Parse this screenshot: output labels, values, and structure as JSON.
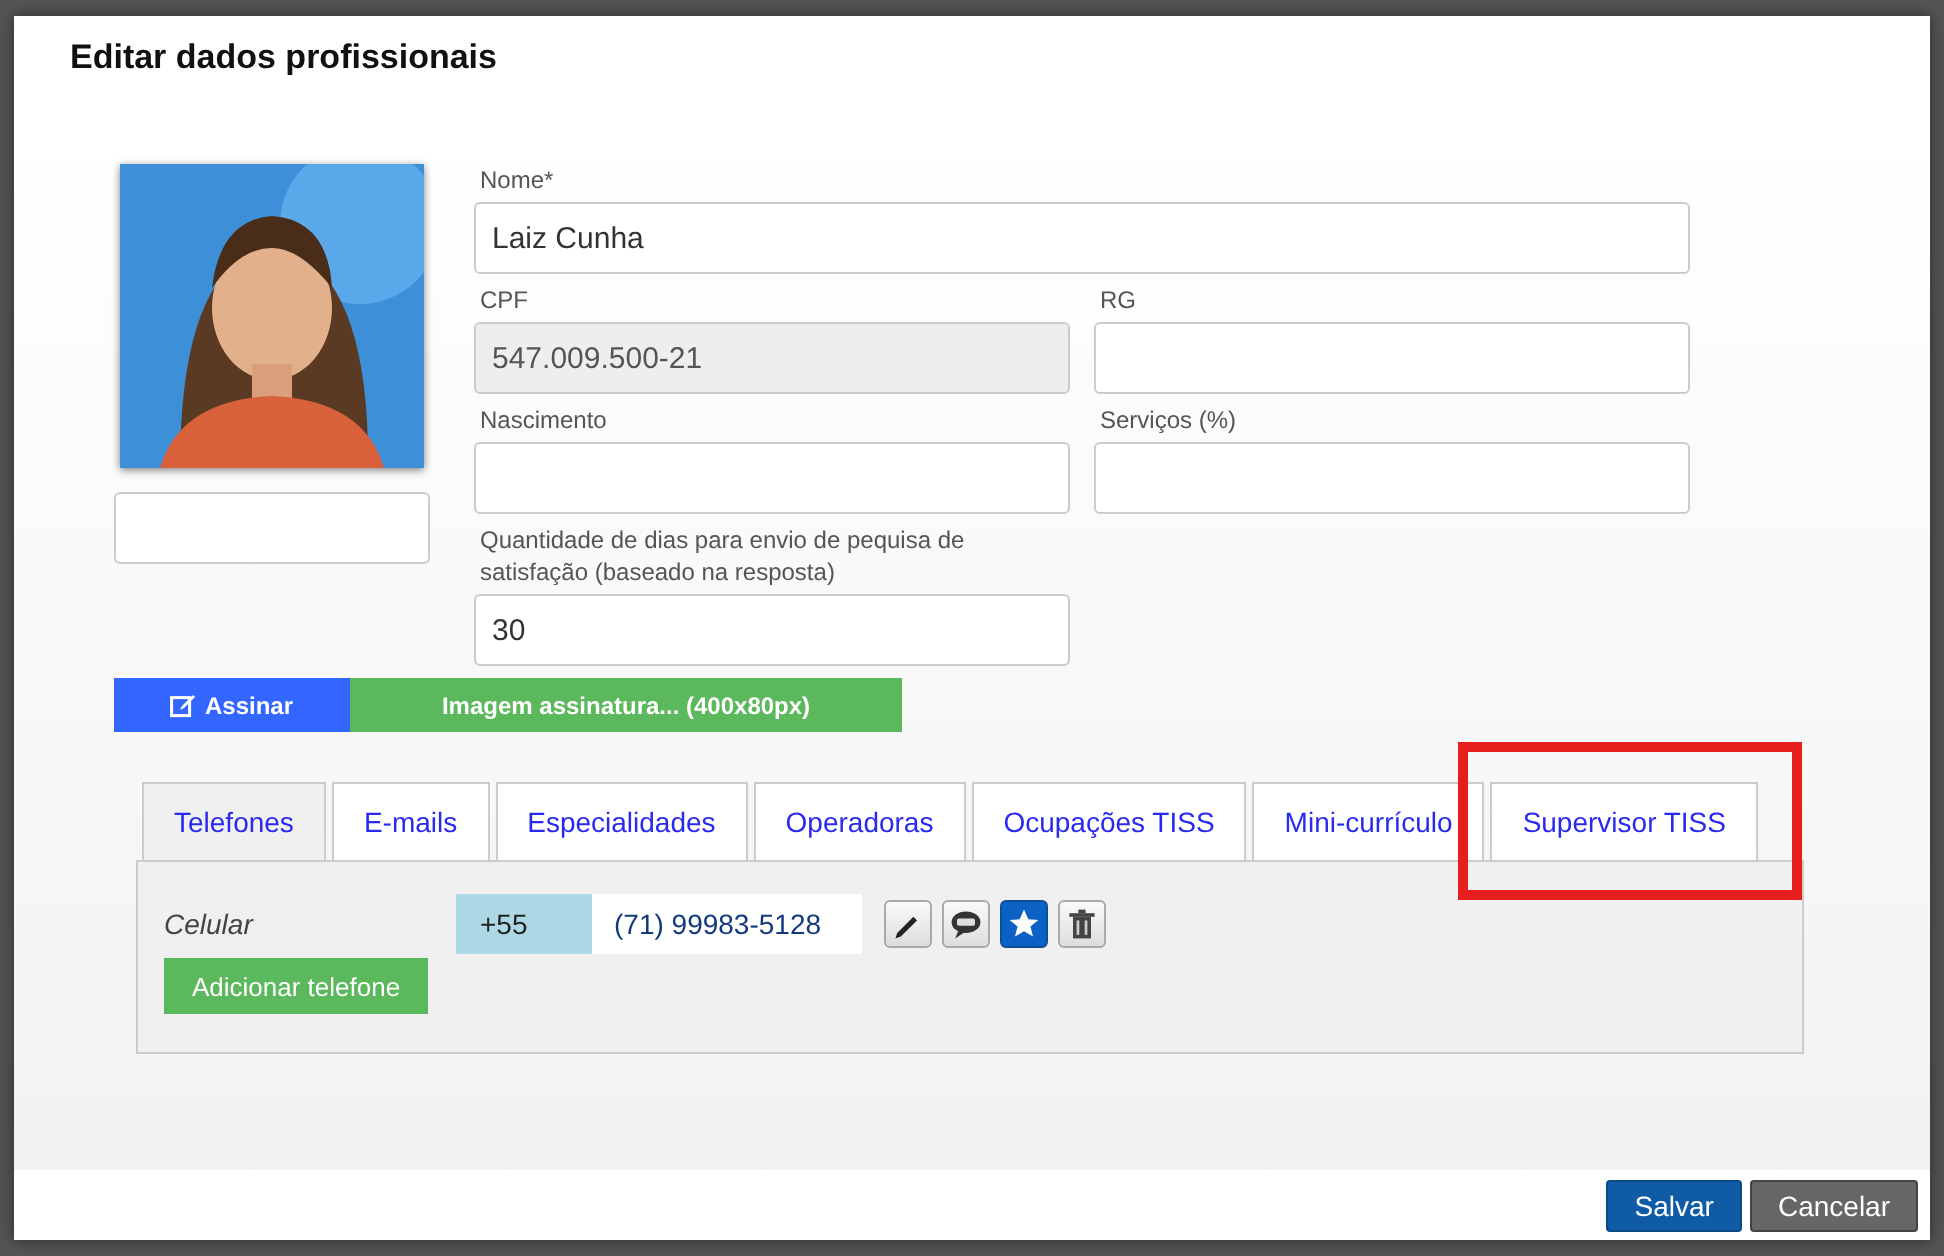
{
  "dialog": {
    "title": "Editar dados profissionais"
  },
  "fields": [
    {
      "label": "Nome*",
      "value": "Laiz Cunha",
      "disabled": false,
      "wide": true
    },
    {
      "label": "CPF",
      "value": "547.009.500-21",
      "disabled": true,
      "wide": false
    },
    {
      "label": "RG",
      "disabled": false,
      "wide": false
    },
    {
      "label": "Nascimento",
      "disabled": false,
      "wide": false
    },
    {
      "label": "Serviços (%)",
      "disabled": false,
      "wide": false
    },
    {
      "label": "Quantidade de dias para envio de pequisa de satisfação (baseado na resposta)",
      "value": "30",
      "disabled": false,
      "wide": false
    }
  ],
  "signature_buttons": {
    "sign": "Assinar",
    "image": "Imagem assinatura... (400x80px)"
  },
  "tabs": [
    {
      "label": "Telefones",
      "selected": true,
      "highlighted": false
    },
    {
      "label": "E-mails",
      "selected": false,
      "highlighted": false
    },
    {
      "label": "Especialidades",
      "selected": false,
      "highlighted": false
    },
    {
      "label": "Operadoras",
      "selected": false,
      "highlighted": false
    },
    {
      "label": "Ocupações TISS",
      "selected": false,
      "highlighted": false
    },
    {
      "label": "Mini-currículo",
      "selected": false,
      "highlighted": false
    },
    {
      "label": "Supervisor TISS",
      "selected": false,
      "highlighted": true
    }
  ],
  "phones": [
    {
      "type": "Celular",
      "country_code": "+55",
      "number": "(71) 99983-5128",
      "favorite": true
    }
  ],
  "add_phone_button": "Adicionar telefone",
  "footer_buttons": [
    {
      "label": "Salvar",
      "kind": "primary"
    },
    {
      "label": "Cancelar",
      "kind": "secondary"
    }
  ]
}
